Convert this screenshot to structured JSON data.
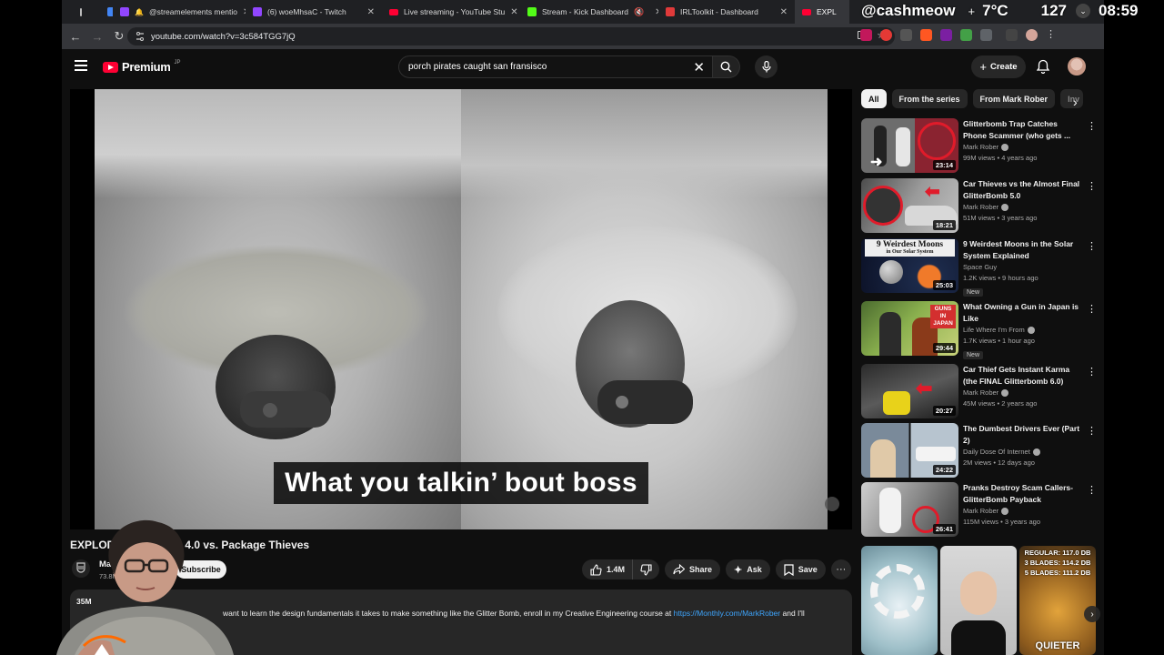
{
  "tabs": [
    {
      "label": "",
      "color": "#4285f4"
    },
    {
      "label": "@streamelements mentio",
      "color": "#9146ff"
    },
    {
      "label": "(6) woeMhsaC - Twitch",
      "color": "#9146ff"
    },
    {
      "label": "Live streaming - YouTube Stu",
      "color": "#ff0033"
    },
    {
      "label": "Stream - Kick Dashboard",
      "color": "#53fc18"
    },
    {
      "label": "IRLToolkit - Dashboard",
      "color": "#e03a3a"
    },
    {
      "label": "EXPL",
      "color": "#ff0033"
    }
  ],
  "overlay": {
    "handle": "@cashmeow",
    "plus": "+",
    "temperature": "7°C",
    "counter": "127",
    "time": "08:59"
  },
  "browser": {
    "url": "youtube.com/watch?v=3c584TGG7jQ"
  },
  "youtube": {
    "brand": "Premium",
    "region": "JP",
    "search_value": "porch pirates caught san fransisco",
    "create_label": "Create"
  },
  "video": {
    "subtitle": "What you talkin’ bout boss",
    "title_start": "EXPLODI",
    "title_end": "omb 4.0 vs. Package Thieves",
    "channel": "Mark",
    "subs": "73.8M su",
    "subscribe_label": "Subscribe",
    "likes": "1.4M",
    "share_label": "Share",
    "ask_label": "Ask",
    "save_label": "Save",
    "desc_views": "35M",
    "desc_text": "want to learn the design fundamentals it takes to make something like the Glitter Bomb, enroll in my Creative Engineering course at",
    "desc_link": "https://Monthly.com/MarkRober",
    "desc_tail": "and I'll"
  },
  "chips": [
    "All",
    "From the series",
    "From Mark Rober",
    "Inv"
  ],
  "recommendations": [
    {
      "title": "Glitterbomb Trap Catches Phone Scammer (who gets ...",
      "channel": "Mark Rober",
      "stats": "99M views • 4 years ago",
      "duration": "23:14",
      "verified": true,
      "new": false
    },
    {
      "title": "Car Thieves vs the Almost Final GlitterBomb 5.0",
      "channel": "Mark Rober",
      "stats": "51M views • 3 years ago",
      "duration": "18:21",
      "verified": true,
      "new": false
    },
    {
      "title": "9 Weirdest Moons in the Solar System Explained",
      "channel": "Space Guy",
      "stats": "1.2K views • 9 hours ago",
      "duration": "25:03",
      "verified": false,
      "new": true,
      "thumb_text": "9 Weirdest Moons",
      "thumb_sub": "in Our Solar System"
    },
    {
      "title": "What Owning a Gun in Japan is Like",
      "channel": "Life Where I'm From",
      "stats": "1.7K views • 1 hour ago",
      "duration": "29:44",
      "verified": true,
      "new": true,
      "thumb_text": "GUNS IN JAPAN"
    },
    {
      "title": "Car Thief Gets Instant Karma (the FINAL Glitterbomb 6.0)",
      "channel": "Mark Rober",
      "stats": "45M views • 2 years ago",
      "duration": "20:27",
      "verified": true,
      "new": false
    },
    {
      "title": "The Dumbest Drivers Ever (Part 2)",
      "channel": "Daily Dose Of Internet",
      "stats": "2M views • 12 days ago",
      "duration": "24:22",
      "verified": true,
      "new": false
    },
    {
      "title": "Pranks Destroy Scam Callers- GlitterBomb Payback",
      "channel": "Mark Rober",
      "stats": "115M views • 3 years ago",
      "duration": "26:41",
      "verified": true,
      "new": false
    }
  ],
  "new_label": "New",
  "shorts": [
    {
      "text": ""
    },
    {
      "text": ""
    },
    {
      "text_top": "REGULAR: 117.0 DB\n3 BLADES: 114.2 DB\n5 BLADES: 111.2 DB",
      "text_bottom": "QUIETER"
    }
  ],
  "colors": {
    "accent": "#ff0033",
    "link": "#3ea6ff",
    "bg": "#0f0f0f",
    "chip": "#272727"
  }
}
